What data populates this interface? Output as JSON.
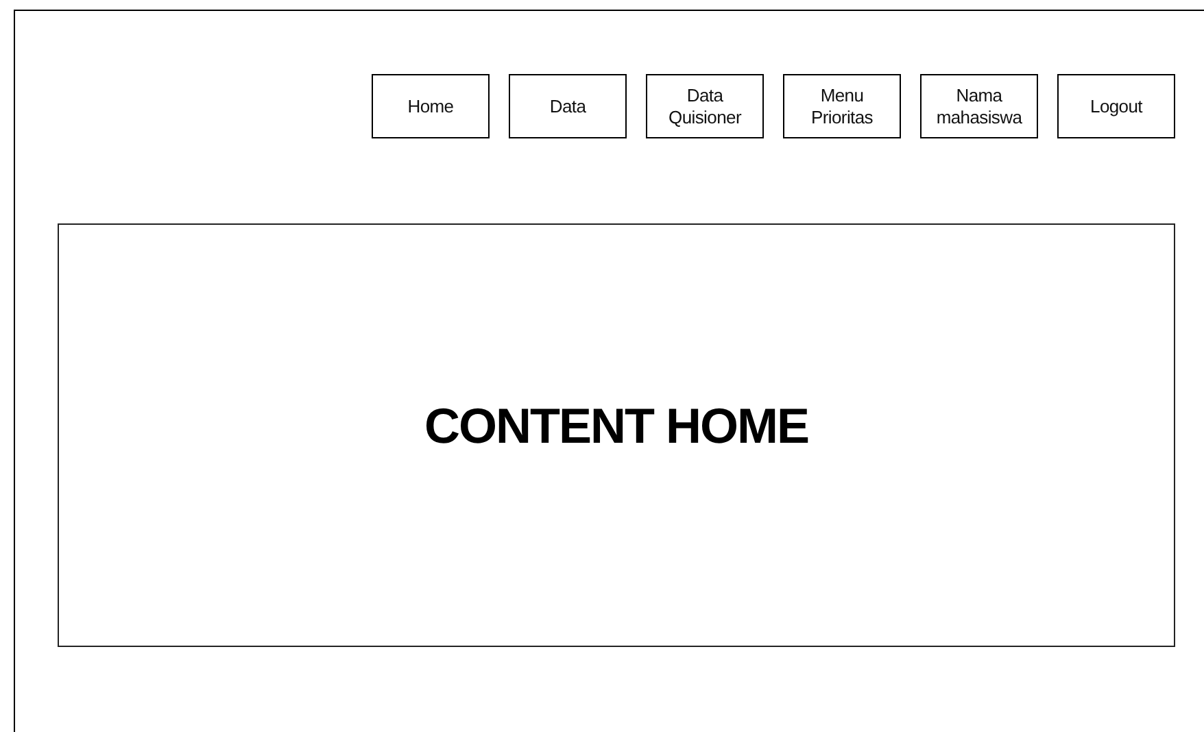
{
  "nav_buttons": [
    {
      "label": "Home"
    },
    {
      "label": "Data"
    },
    {
      "label": "Data Quisioner"
    },
    {
      "label": "Menu Prioritas"
    },
    {
      "label": "Nama mahasiswa"
    },
    {
      "label": "Logout"
    }
  ],
  "content": {
    "title": "CONTENT HOME"
  }
}
